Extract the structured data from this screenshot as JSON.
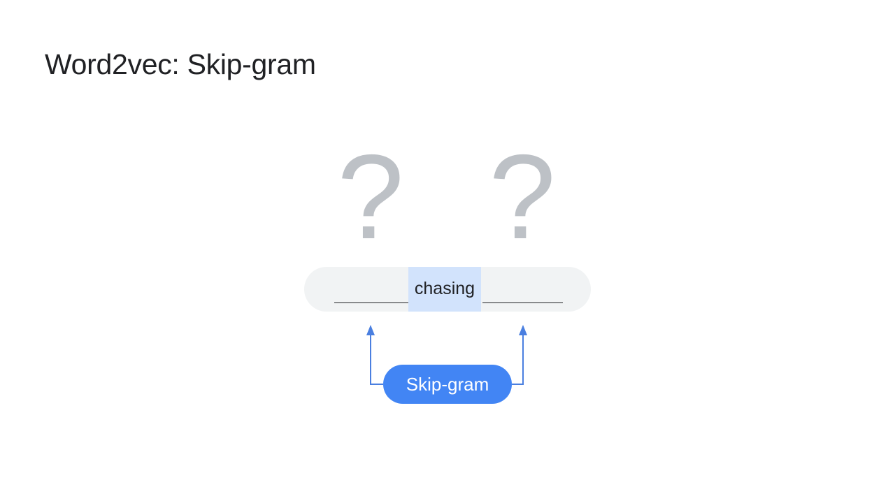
{
  "slide": {
    "title": "Word2vec: Skip-gram"
  },
  "diagram": {
    "left_context_word": "?",
    "right_context_word": "?",
    "center_word": "chasing",
    "model_label": "Skip-gram"
  },
  "colors": {
    "title_text": "#202124",
    "question_mark": "#bdc1c6",
    "sentence_bar": "#f1f3f4",
    "center_word_highlight": "#d2e3fc",
    "model_pill": "#4285f4",
    "arrow": "#4a7fe0"
  }
}
